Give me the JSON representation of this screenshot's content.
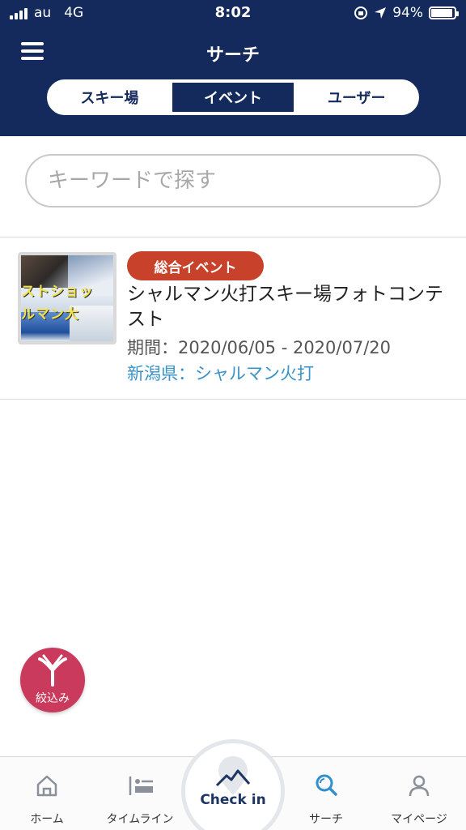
{
  "status_bar": {
    "carrier": "au",
    "network": "4G",
    "time": "8:02",
    "battery": "94%",
    "battery_level": 0.94
  },
  "header": {
    "title": "サーチ",
    "menu_icon": "hamburger-icon"
  },
  "segments": [
    {
      "label": "スキー場",
      "active": false
    },
    {
      "label": "イベント",
      "active": true
    },
    {
      "label": "ユーザー",
      "active": false
    }
  ],
  "search": {
    "placeholder": "キーワードで探す",
    "value": ""
  },
  "events": [
    {
      "badge": "総合イベント",
      "title": "シャルマン火打スキー場フォトコンテスト",
      "period": "期間：2020/06/05 - 2020/07/20",
      "location": "新潟県：シャルマン火打",
      "thumbnail_text_1": "ストショッ",
      "thumbnail_text_2": "ルマン大"
    }
  ],
  "filter_button": {
    "label": "絞込み",
    "icon": "filter-y-icon"
  },
  "tab_bar": {
    "items": [
      {
        "label": "ホーム",
        "icon": "home-icon",
        "active": false
      },
      {
        "label": "タイムライン",
        "icon": "timeline-icon",
        "active": false
      },
      {
        "label": "Check in",
        "icon": "checkin-pin-icon",
        "active": false
      },
      {
        "label": "サーチ",
        "icon": "search-icon",
        "active": true
      },
      {
        "label": "マイページ",
        "icon": "user-icon",
        "active": false
      }
    ]
  },
  "colors": {
    "header_bg": "#142a5c",
    "badge": "#c8412a",
    "location_link": "#3a93c8",
    "filter_button": "#c93a5c",
    "active_tab_icon": "#2f8fd1"
  }
}
